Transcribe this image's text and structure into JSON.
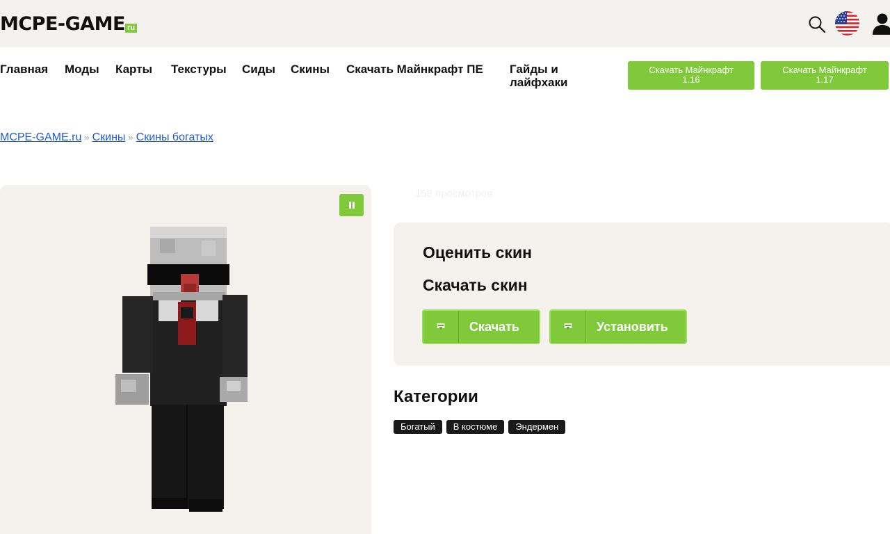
{
  "header": {
    "logo_main": "MCPE-GAME",
    "logo_suffix": "ru"
  },
  "nav": {
    "items": [
      "Главная",
      "Моды",
      "Карты",
      "Текстуры",
      "Сиды",
      "Скины",
      "Скачать Майнкрафт ПЕ",
      "Гайды и лайфхаки"
    ],
    "buttons": [
      {
        "line1": "Скачать Майнкрафт",
        "line2": "1.16"
      },
      {
        "line1": "Скачать Майнкрафт",
        "line2": "1.17"
      }
    ]
  },
  "breadcrumb": {
    "items": [
      "MCPE-GAME.ru",
      "Скины",
      "Скины богатых"
    ],
    "separator": "»"
  },
  "views": "158 просмотров",
  "panel": {
    "rate_title": "Оценить скин",
    "download_title": "Скачать скин",
    "download_label": "Скачать",
    "install_label": "Установить"
  },
  "categories": {
    "title": "Категории",
    "tags": [
      "Богатый",
      "В костюме",
      "Эндермен"
    ]
  },
  "colors": {
    "accent": "#7fc93a",
    "link": "#1e5ad8",
    "panel_bg": "#f5f2ed",
    "header_bg": "#f4f2ee"
  }
}
